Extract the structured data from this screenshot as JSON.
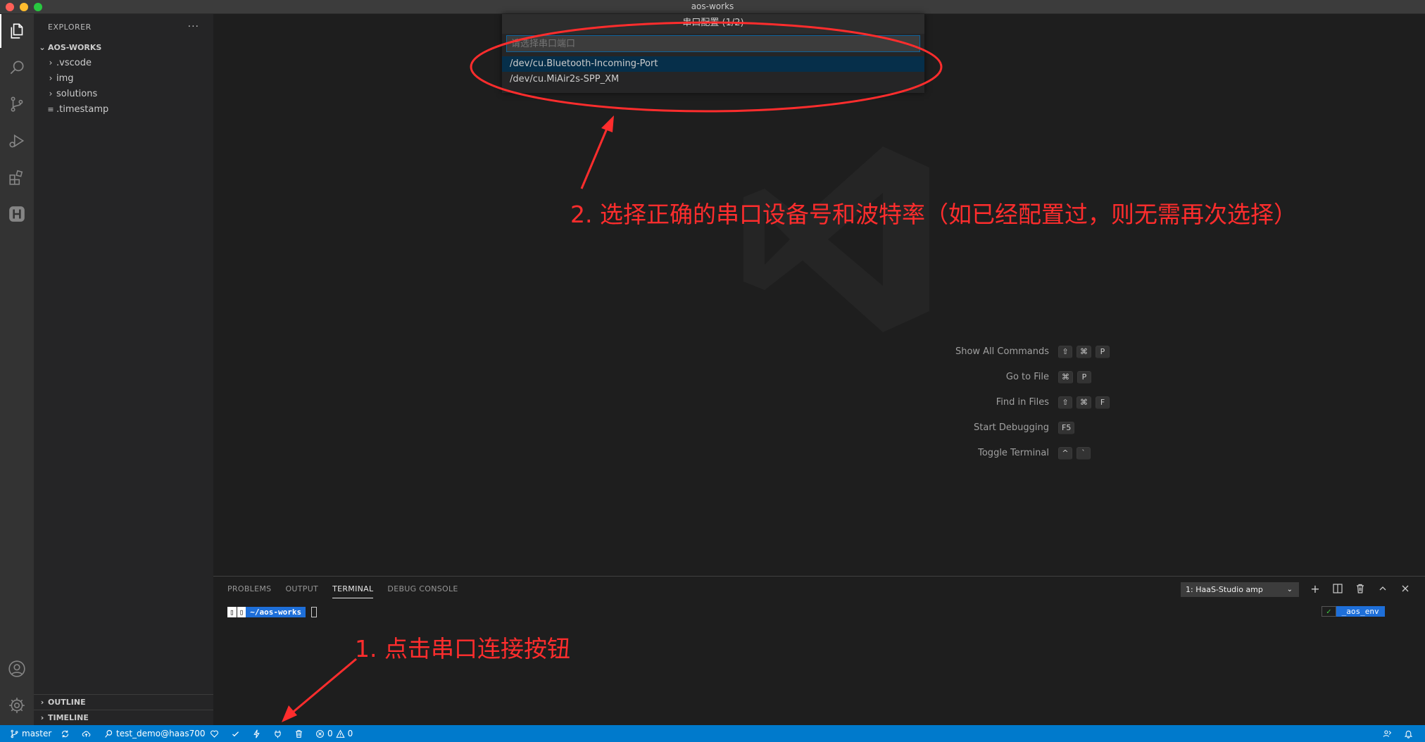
{
  "window": {
    "title": "aos-works"
  },
  "sidebar": {
    "header": "EXPLORER",
    "more": "···",
    "root": "AOS-WORKS",
    "items": [
      {
        "label": ".vscode",
        "type": "folder"
      },
      {
        "label": "img",
        "type": "folder"
      },
      {
        "label": "solutions",
        "type": "folder"
      },
      {
        "label": ".timestamp",
        "type": "file"
      }
    ],
    "outline": "OUTLINE",
    "timeline": "TIMELINE"
  },
  "quickpick": {
    "title": "串口配置 (1/2)",
    "placeholder": "请选择串口端口",
    "items": [
      "/dev/cu.Bluetooth-Incoming-Port",
      "/dev/cu.MiAir2s-SPP_XM"
    ]
  },
  "shortcuts": [
    {
      "label": "Show All Commands",
      "keys": [
        "⇧",
        "⌘",
        "P"
      ]
    },
    {
      "label": "Go to File",
      "keys": [
        "⌘",
        "P"
      ]
    },
    {
      "label": "Find in Files",
      "keys": [
        "⇧",
        "⌘",
        "F"
      ]
    },
    {
      "label": "Start Debugging",
      "keys": [
        "F5"
      ]
    },
    {
      "label": "Toggle Terminal",
      "keys": [
        "^",
        "`"
      ]
    }
  ],
  "annotations": {
    "step2": "2. 选择正确的串口设备号和波特率（如已经配置过，则无需再次选择）",
    "step1": "1. 点击串口连接按钮",
    "color": "#ff2d2d"
  },
  "panel": {
    "tabs": [
      "PROBLEMS",
      "OUTPUT",
      "TERMINAL",
      "DEBUG CONSOLE"
    ],
    "active_tab": "TERMINAL",
    "terminal_select": "1: HaaS-Studio amp",
    "prompt_segments": [
      "",
      ""
    ],
    "prompt_path": "~/aos-works",
    "rprompt_ok": "✓",
    "rprompt_env": "_aos_env"
  },
  "statusbar": {
    "branch": "master",
    "device": "test_demo@haas700",
    "errors": "0",
    "warnings": "0",
    "color": "#007acc"
  }
}
